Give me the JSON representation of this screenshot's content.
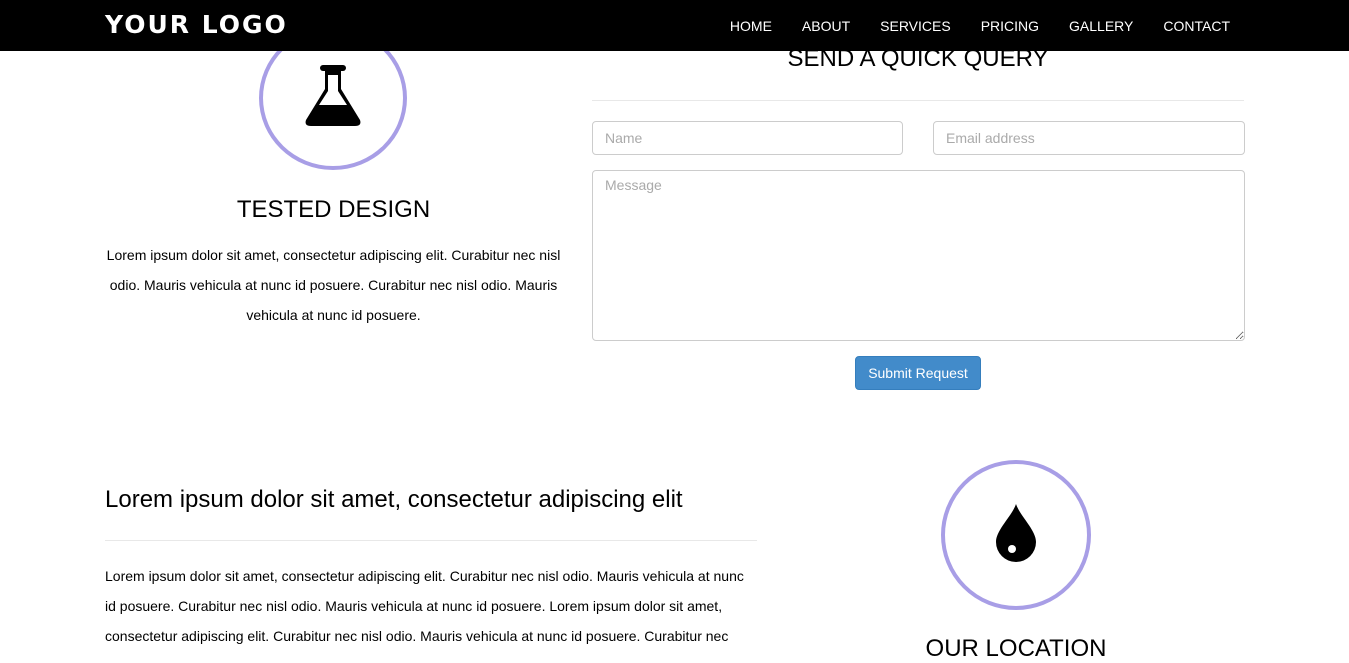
{
  "navbar": {
    "logo": "YOUR LOGO",
    "links": [
      "HOME",
      "ABOUT",
      "SERVICES",
      "PRICING",
      "GALLERY",
      "CONTACT"
    ]
  },
  "feature_left": {
    "icon": "flask-icon",
    "title": "TESTED DESIGN",
    "text": "Lorem ipsum dolor sit amet, consectetur adipiscing elit. Curabitur nec nisl odio. Mauris vehicula at nunc id posuere. Curabitur nec nisl odio. Mauris vehicula at nunc id posuere."
  },
  "query_form": {
    "title": "SEND A QUICK QUERY",
    "name_placeholder": "Name",
    "email_placeholder": "Email address",
    "message_placeholder": "Message",
    "submit_label": "Submit Request"
  },
  "section": {
    "heading": "Lorem ipsum dolor sit amet, consectetur adipiscing elit",
    "text": "Lorem ipsum dolor sit amet, consectetur adipiscing elit. Curabitur nec nisl odio. Mauris vehicula at nunc id posuere. Curabitur nec nisl odio. Mauris vehicula at nunc id posuere. Lorem ipsum dolor sit amet, consectetur adipiscing elit. Curabitur nec nisl odio. Mauris vehicula at nunc id posuere. Curabitur nec"
  },
  "feature_right": {
    "icon": "water-drop-icon",
    "title": "OUR LOCATION"
  },
  "colors": {
    "navbar_bg": "#000000",
    "circle_border": "#a89ee6",
    "button_primary": "#428bca"
  }
}
